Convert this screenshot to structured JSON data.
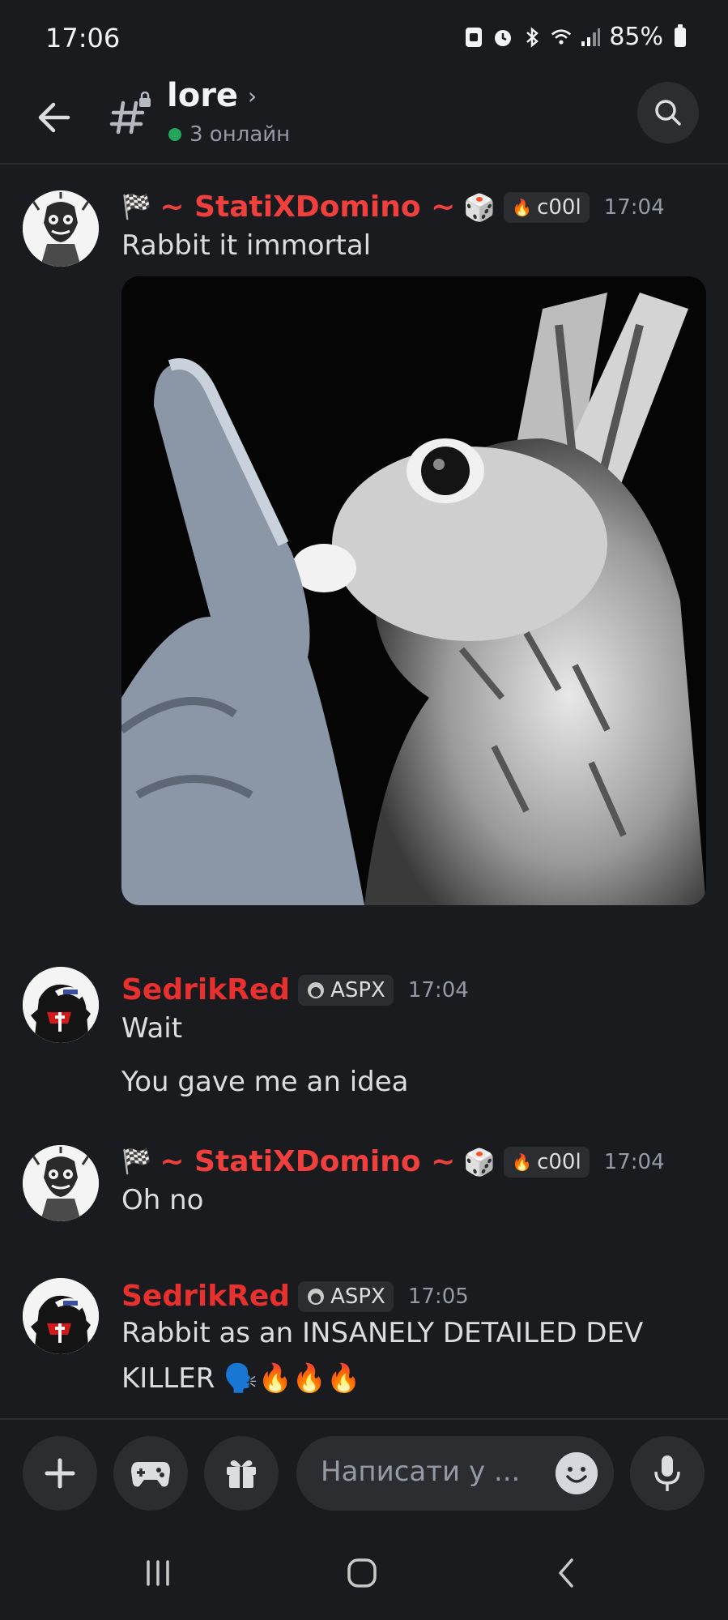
{
  "status_bar": {
    "time": "17:06",
    "battery": "85%",
    "icons": [
      "sim-icon",
      "alarm-icon",
      "bluetooth-icon",
      "wifi-icon",
      "signal-icon",
      "battery-icon"
    ]
  },
  "header": {
    "channel_name": "lore",
    "online_text": "3 онлайн",
    "channel_icon": "text-channel-icon"
  },
  "messages": [
    {
      "username": "~ StatiXDomino ~",
      "username_color": "#f0403d",
      "prefix_icon": "🏁",
      "suffix_icon": "🎲",
      "tag": "c00l",
      "tag_icon": "🔥",
      "time": "17:04",
      "lines": [
        "Rabbit it immortal"
      ],
      "has_image": true
    },
    {
      "username": "SedrikRed",
      "username_color": "#e8312f",
      "tag": "ASPX",
      "time": "17:04",
      "lines": [
        "Wait",
        "You gave me an idea"
      ]
    },
    {
      "username": "~ StatiXDomino ~",
      "username_color": "#f0403d",
      "prefix_icon": "🏁",
      "suffix_icon": "🎲",
      "tag": "c00l",
      "tag_icon": "🔥",
      "time": "17:04",
      "lines": [
        "Oh no"
      ]
    },
    {
      "username": "SedrikRed",
      "username_color": "#e8312f",
      "tag": "ASPX",
      "time": "17:05",
      "lines": [
        "Rabbit as an INSANELY DETAILED DEV",
        "KILLER 🗣️🔥🔥🔥"
      ]
    }
  ],
  "composer": {
    "placeholder": "Написати у ..."
  },
  "colors": {
    "background": "#1a1b1f",
    "surface": "#2b2d31",
    "online": "#23a55a",
    "muted": "#949ba4"
  }
}
